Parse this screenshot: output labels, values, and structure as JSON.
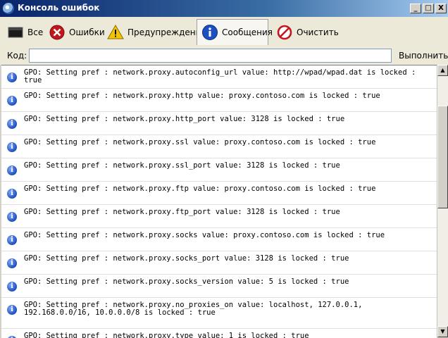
{
  "window": {
    "title": "Консоль ошибок",
    "min": "_",
    "max": "□",
    "close": "X"
  },
  "toolbar": {
    "all_label": "Все",
    "errors_label": "Ошибки",
    "warnings_label": "Предупреждения",
    "messages_label": "Сообщения",
    "clear_label": "Очистить",
    "active_tab": "Сообщения"
  },
  "codebar": {
    "label": "Код:",
    "value": "",
    "run_label": "Выполнить"
  },
  "icons": {
    "all": "console-icon",
    "errors": "error-icon",
    "warnings": "warning-icon",
    "messages": "info-icon",
    "clear": "clear-icon"
  },
  "colors": {
    "titlebar": "#0a246a",
    "info_icon": "#1e4fc0",
    "error_icon": "#c0161c",
    "warning_icon": "#f5c400"
  },
  "messages": [
    {
      "text": "GPO: Setting pref : network.proxy.autoconfig_url value: http://wpad/wpad.dat is locked : true"
    },
    {
      "text": "GPO: Setting pref : network.proxy.http value: proxy.contoso.com is locked : true"
    },
    {
      "text": "GPO: Setting pref : network.proxy.http_port value: 3128 is locked : true"
    },
    {
      "text": "GPO: Setting pref : network.proxy.ssl value: proxy.contoso.com is locked : true"
    },
    {
      "text": "GPO: Setting pref : network.proxy.ssl_port value: 3128 is locked : true"
    },
    {
      "text": "GPO: Setting pref : network.proxy.ftp value: proxy.contoso.com is locked : true"
    },
    {
      "text": "GPO: Setting pref : network.proxy.ftp_port value: 3128 is locked : true"
    },
    {
      "text": "GPO: Setting pref : network.proxy.socks value: proxy.contoso.com is locked : true"
    },
    {
      "text": "GPO: Setting pref : network.proxy.socks_port value: 3128 is locked : true"
    },
    {
      "text": "GPO: Setting pref : network.proxy.socks_version value: 5 is locked : true"
    },
    {
      "text": "GPO: Setting pref : network.proxy.no_proxies_on value: localhost, 127.0.0.1, 192.168.0.0/16, 10.0.0.0/8 is locked : true"
    },
    {
      "text": "GPO: Setting pref : network.proxy.type value: 1 is locked : true"
    }
  ]
}
